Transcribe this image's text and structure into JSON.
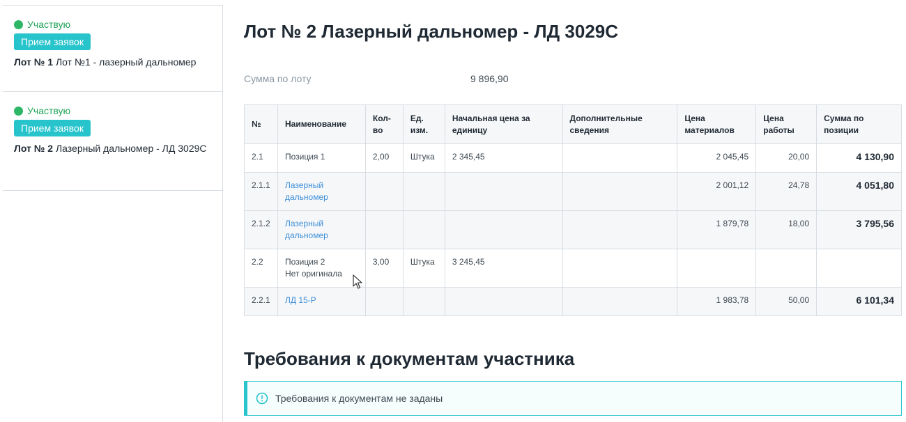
{
  "sidebar": {
    "lots": [
      {
        "status": "Участвую",
        "badge": "Прием заявок",
        "prefix": "Лот № 1",
        "name": "Лот №1 - лазерный дальномер"
      },
      {
        "status": "Участвую",
        "badge": "Прием заявок",
        "prefix": "Лот № 2",
        "name": "Лазерный дальномер - ЛД 3029С"
      }
    ]
  },
  "main": {
    "title": "Лот № 2 Лазерный дальномер - ЛД 3029С",
    "sum_label": "Сумма по лоту",
    "sum_value": "9 896,90",
    "table": {
      "headers": [
        "№",
        "Наименование",
        "Кол-во",
        "Ед. изм.",
        "Начальная цена за единицу",
        "Дополнительные сведения",
        "Цена материалов",
        "Цена работы",
        "Сумма по позиции"
      ],
      "rows": [
        {
          "no": "2.1",
          "name": "Позиция 1",
          "qty": "2,00",
          "unit": "Штука",
          "price": "2 345,45",
          "extra": "",
          "materials": "2 045,45",
          "work": "20,00",
          "total": "4 130,90"
        },
        {
          "no": "2.1.1",
          "name": "Лазерный дальномер",
          "qty": "",
          "unit": "",
          "price": "",
          "extra": "",
          "materials": "2 001,12",
          "work": "24,78",
          "total": "4 051,80"
        },
        {
          "no": "2.1.2",
          "name": "Лазерный дальномер",
          "qty": "",
          "unit": "",
          "price": "",
          "extra": "",
          "materials": "1 879,78",
          "work": "18,00",
          "total": "3 795,56"
        },
        {
          "no": "2.2",
          "name": "Позиция 2",
          "note": "Нет оригинала",
          "qty": "3,00",
          "unit": "Штука",
          "price": "3 245,45",
          "extra": "",
          "materials": "",
          "work": "",
          "total": ""
        },
        {
          "no": "2.2.1",
          "name": "ЛД 15-Р",
          "qty": "",
          "unit": "",
          "price": "",
          "extra": "",
          "materials": "1 983,78",
          "work": "50,00",
          "total": "6 101,34"
        }
      ]
    },
    "requirements_title": "Требования к документам участника",
    "requirements_notice": "Требования к документам не заданы"
  },
  "colors": {
    "accent": "#27c4cc",
    "status_green": "#2cb665",
    "link": "#3d8fd8"
  },
  "icons": [
    "status-dot-icon",
    "info-icon",
    "mouse-cursor-icon"
  ]
}
